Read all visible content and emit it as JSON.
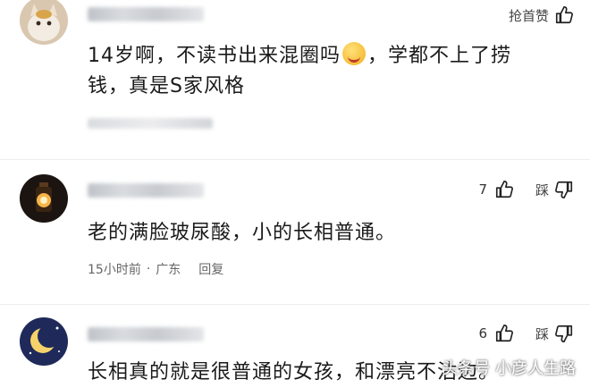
{
  "comments": [
    {
      "like_label": "抢首赞",
      "text_line1_a": "14岁啊，不读书出来混圈吗",
      "text_line1_b": "，学都不上了捞",
      "text_line2": "钱，真是S家风格"
    },
    {
      "like_count": "7",
      "dislike_label": "踩",
      "text": "老的满脸玻尿酸，小的长相普通。",
      "time": "15小时前",
      "sep": "·",
      "location": "广东",
      "reply_label": "回复"
    },
    {
      "like_count": "6",
      "dislike_label": "踩",
      "text": "长相真的就是很普通的女孩，和漂亮不沾边。"
    }
  ],
  "watermark": "头条号 小彦人生路"
}
